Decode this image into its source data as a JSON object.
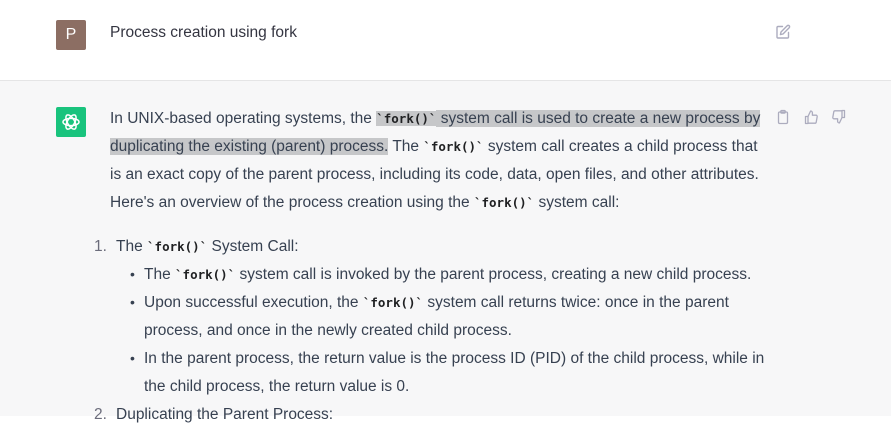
{
  "user": {
    "avatar_letter": "P",
    "message": "Process creation using fork"
  },
  "assistant": {
    "intro": {
      "p1": "In UNIX-based operating systems, the ",
      "code1": "`fork()`",
      "p2": " system call is used to create a new process by duplicating the existing (parent) process.",
      "p3": " The ",
      "code2": "`fork()`",
      "p4": " system call creates a child process that is an exact copy of the parent process, including its code, data, open files, and other attributes. Here's an overview of the process creation using the ",
      "code3": "`fork()`",
      "p5": " system call:"
    },
    "list": [
      {
        "number": "1.",
        "title_prefix": "The ",
        "title_code": "`fork()`",
        "title_suffix": " System Call:",
        "bullets": [
          {
            "a": "The ",
            "code": "`fork()`",
            "b": " system call is invoked by the parent process, creating a new child process."
          },
          {
            "a": "Upon successful execution, the ",
            "code": "`fork()`",
            "b": " system call returns twice: once in the parent process, and once in the newly created child process."
          },
          {
            "a": "In the parent process, the return value is the process ID (PID) of the child process, while in the child process, the return value is 0.",
            "code": "",
            "b": ""
          }
        ]
      },
      {
        "number": "2.",
        "title_prefix": "Duplicating the Parent Process:",
        "title_code": "",
        "title_suffix": ""
      }
    ]
  },
  "colors": {
    "user_avatar": "#8c6e63",
    "assistant_avatar": "#19c37d",
    "selection_highlight": "#c6c7c9",
    "assistant_bg": "#f7f7f8"
  },
  "icons": {
    "edit": "edit-icon",
    "copy": "clipboard-icon",
    "like": "thumbs-up-icon",
    "dislike": "thumbs-down-icon"
  }
}
